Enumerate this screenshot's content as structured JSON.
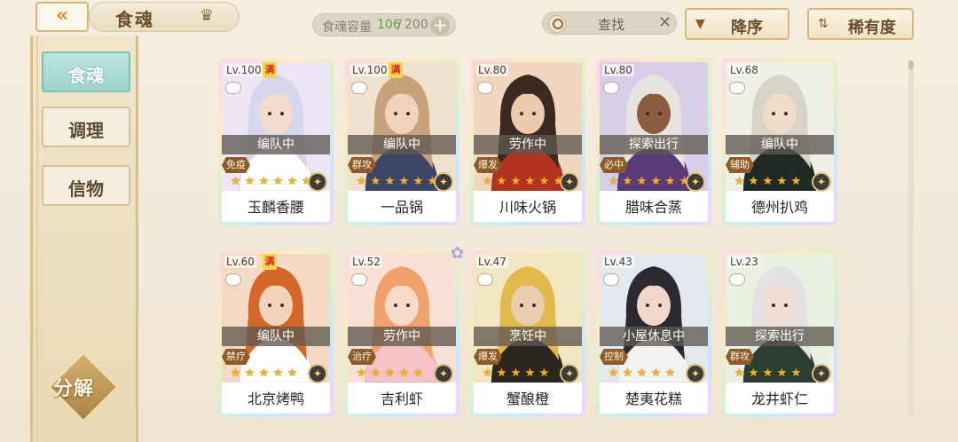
{
  "header": {
    "back_icon": "double-chevron-left-icon",
    "title": "食魂",
    "crown_icon": "crown-icon",
    "capacity": {
      "label": "食魂容量",
      "current": "106",
      "separator": "/",
      "max": "200",
      "add": "+"
    },
    "search": {
      "text": "查找",
      "close": "✕"
    },
    "sort_desc": {
      "label": "降序",
      "icon": "triangle-down-icon"
    },
    "sort_rarity": {
      "label": "稀有度",
      "icon": "sort-arrows-icon"
    }
  },
  "sidebar": {
    "tabs": [
      {
        "label": "食魂",
        "active": true
      },
      {
        "label": "调理",
        "active": false
      },
      {
        "label": "信物",
        "active": false
      }
    ],
    "decompose": {
      "label": "分解"
    }
  },
  "cards": [
    {
      "level": "Lv.100",
      "max": "满",
      "status": "编队中",
      "role": "免疫",
      "stars": 6,
      "name": "玉麟香腰",
      "hair": "#d9d6ef",
      "bg": "#eee6f5",
      "skin": "#f4dccd",
      "outfit": "#ffffff"
    },
    {
      "level": "Lv.100",
      "max": "满",
      "status": "编队中",
      "role": "群攻",
      "stars": 6,
      "name": "一品锅",
      "hair": "#c7a27a",
      "bg": "#efe2cf",
      "skin": "#f1d2bc",
      "outfit": "#3c4568"
    },
    {
      "level": "Lv.80",
      "max": "",
      "status": "劳作中",
      "role": "爆发",
      "stars": 6,
      "name": "川味火锅",
      "hair": "#3b2a22",
      "bg": "#f2d7c0",
      "skin": "#efc9ad",
      "outfit": "#b2311f"
    },
    {
      "level": "Lv.80",
      "max": "",
      "status": "探索出行",
      "role": "必中",
      "stars": 6,
      "name": "腊味合蒸",
      "hair": "#e7e3df",
      "bg": "#d7cfe8",
      "skin": "#8a5c40",
      "outfit": "#5a3b78"
    },
    {
      "level": "Lv.68",
      "max": "",
      "status": "编队中",
      "role": "辅助",
      "stars": 5,
      "name": "德州扒鸡",
      "hair": "#d8d4c7",
      "bg": "#eef0e6",
      "skin": "#f1dcca",
      "outfit": "#1f2a24"
    },
    {
      "level": "Lv.60",
      "max": "满",
      "status": "编队中",
      "role": "禁疗",
      "stars": 5,
      "name": "北京烤鸭",
      "hair": "#d4682a",
      "bg": "#f4d9c3",
      "skin": "#f3d3b9",
      "outfit": "#ffffff"
    },
    {
      "level": "Lv.52",
      "max": "",
      "status": "劳作中",
      "role": "治疗",
      "stars": 5,
      "name": "吉利虾",
      "hair": "#f0a16c",
      "bg": "#fbe0d5",
      "skin": "#f8dac8",
      "outfit": "#f5c2c6"
    },
    {
      "level": "Lv.47",
      "max": "",
      "status": "烹饪中",
      "role": "爆发",
      "stars": 5,
      "name": "蟹酿橙",
      "hair": "#e2b94b",
      "bg": "#f3e6c2",
      "skin": "#eccdb0",
      "outfit": "#2c2620"
    },
    {
      "level": "Lv.43",
      "max": "",
      "status": "小屋休息中",
      "role": "控制",
      "stars": 5,
      "name": "楚夷花糕",
      "hair": "#2c2a30",
      "bg": "#e4e9ef",
      "skin": "#efd8c8",
      "outfit": "#f2f2f2"
    },
    {
      "level": "Lv.23",
      "max": "",
      "status": "探索出行",
      "role": "群攻",
      "stars": 5,
      "name": "龙井虾仁",
      "hair": "#e4e1e4",
      "bg": "#e9f1e2",
      "skin": "#f2ddd0",
      "outfit": "#2c3e32"
    }
  ]
}
